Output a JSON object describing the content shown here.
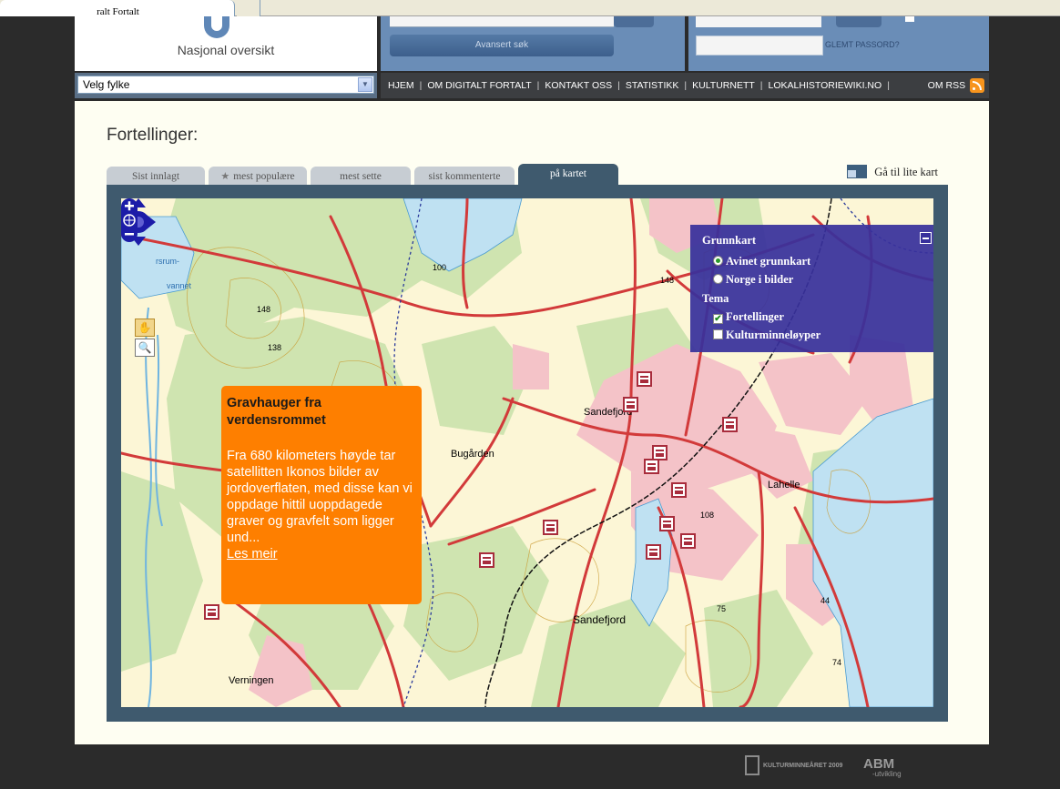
{
  "browser": {
    "tab_title": "ralt Fortalt"
  },
  "header": {
    "logo_text": "Nasjonal oversikt",
    "advanced_search": "Avansert søk",
    "forgot_password": "GLEMT PASSORD?"
  },
  "county_select": {
    "value": "Velg fylke"
  },
  "nav": {
    "items": [
      "HJEM",
      "OM DIGITALT FORTALT",
      "KONTAKT OSS",
      "STATISTIKK",
      "KULTURNETT",
      "LOKALHISTORIEWIKI.NO"
    ],
    "rss": "OM RSS"
  },
  "page": {
    "title": "Fortellinger:",
    "small_map_link": "Gå til lite kart",
    "tabs": [
      {
        "label": "Sist innlagt"
      },
      {
        "label": "mest populære"
      },
      {
        "label": "mest sette"
      },
      {
        "label": "sist kommenterte"
      },
      {
        "label": "på kartet"
      }
    ]
  },
  "map": {
    "place_labels": [
      "Sandefjord",
      "Sandefjord",
      "Bugården",
      "Lahelle",
      "Verningen",
      "148",
      "138",
      "100",
      "148",
      "108",
      "75",
      "44",
      "74",
      "rsrum-",
      "vannet"
    ],
    "popup": {
      "title": "Gravhauger fra verdensrommet",
      "text": "Fra 680 kilometers høyde tar satellitten Ikonos bilder av jordoverflaten, med disse kan vi oppdage hittil uoppdagede graver og gravfelt som ligger und...",
      "link": "Les meir"
    },
    "layers": {
      "basemap_heading": "Grunnkart",
      "basemaps": [
        {
          "label": "Avinet grunnkart",
          "selected": true
        },
        {
          "label": "Norge i bilder",
          "selected": false
        }
      ],
      "theme_heading": "Tema",
      "themes": [
        {
          "label": "Fortellinger",
          "checked": true
        },
        {
          "label": "Kulturminneløyper",
          "checked": false
        }
      ]
    }
  },
  "footer": {
    "logo1": "KULTURMINNEÅRET 2009",
    "logo2": "ABM",
    "logo2_sub": "-utvikling"
  }
}
